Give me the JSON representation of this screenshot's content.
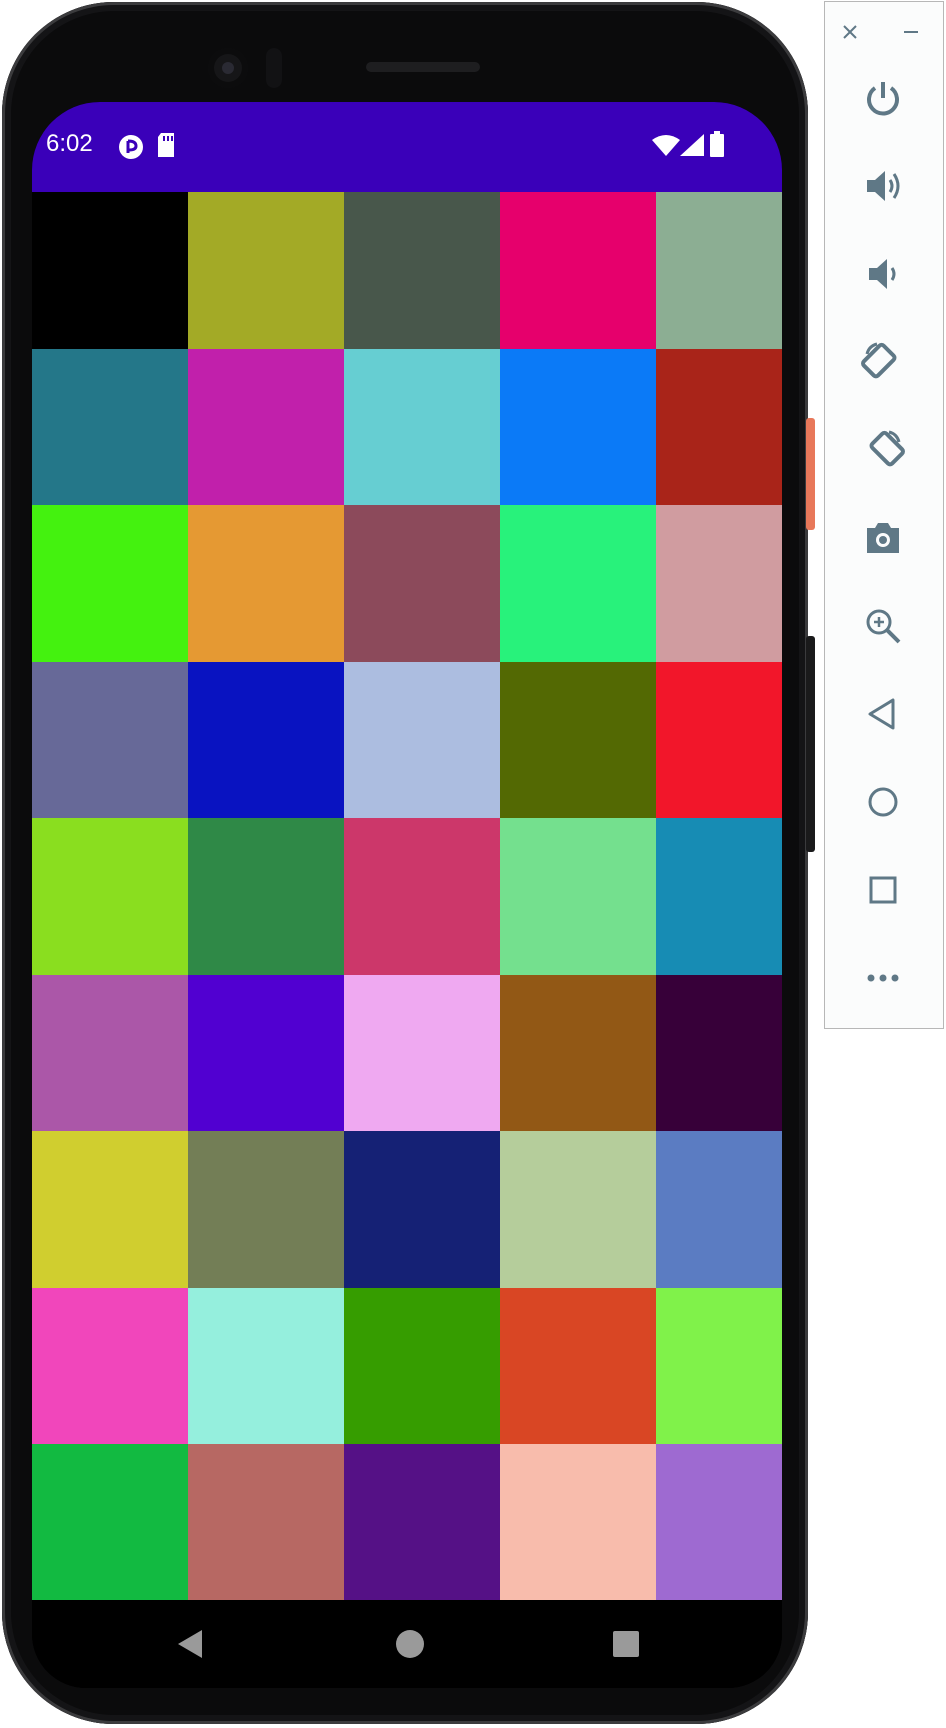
{
  "status_bar": {
    "time": "6:02",
    "background": "#3a00b9",
    "left_icons": [
      "data-usage-icon",
      "sd-card-icon"
    ],
    "right_icons": [
      "wifi-icon",
      "signal-icon",
      "battery-icon"
    ]
  },
  "grid": {
    "columns": 5,
    "rows": 9,
    "tiles": [
      "#000000",
      "#a3aa26",
      "#48574b",
      "#e6006c",
      "#8cae93",
      "#247789",
      "#c120ab",
      "#66ced2",
      "#0b7af7",
      "#a92419",
      "#44f20f",
      "#e59933",
      "#8c4a5b",
      "#28f27b",
      "#d09ca0",
      "#676998",
      "#0913c1",
      "#acbde0",
      "#536903",
      "#f2162a",
      "#8ade1f",
      "#2f8947",
      "#cc376a",
      "#74e08e",
      "#178cb4",
      "#ab57a8",
      "#5100d1",
      "#efa9f1",
      "#925815",
      "#370039",
      "#d0ce2f",
      "#737e56",
      "#152175",
      "#b5cd9b",
      "#5b7cc2",
      "#f146bb",
      "#95efdd",
      "#369d00",
      "#d94624",
      "#80f24a",
      "#12ba41",
      "#b76863",
      "#551186",
      "#f8bcac",
      "#9e6ad1"
    ]
  },
  "nav_bar": {
    "buttons": [
      "back-icon",
      "home-icon",
      "recents-icon"
    ]
  },
  "emulator_panel": {
    "window_controls": [
      "close-icon",
      "minimize-icon"
    ],
    "buttons": [
      "power-icon",
      "volume-up-icon",
      "volume-down-icon",
      "rotate-left-icon",
      "rotate-right-icon",
      "camera-icon",
      "zoom-icon",
      "back-icon",
      "home-icon",
      "overview-icon",
      "more-icon"
    ],
    "icon_color": "#5f7886"
  }
}
